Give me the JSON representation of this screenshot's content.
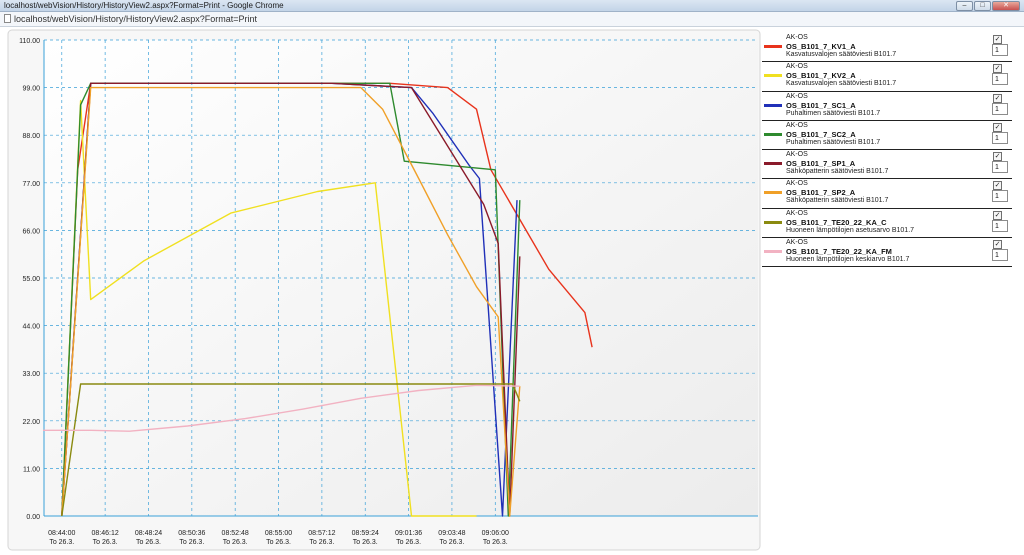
{
  "window": {
    "title": "localhost/webVision/History/HistoryView2.aspx?Format=Print - Google Chrome",
    "url": "localhost/webVision/History/HistoryView2.aspx?Format=Print"
  },
  "chart_data": {
    "type": "line",
    "grid": true,
    "legend_position": "right",
    "ylim": [
      0,
      110
    ],
    "yticks": [
      "0.00",
      "11.00",
      "22.00",
      "33.00",
      "44.00",
      "55.00",
      "66.00",
      "77.00",
      "88.00",
      "99.00",
      "110.00"
    ],
    "xticks": [
      {
        "time": "08:44:00",
        "date": "To 26.3."
      },
      {
        "time": "08:46:12",
        "date": "To 26.3."
      },
      {
        "time": "08:48:24",
        "date": "To 26.3."
      },
      {
        "time": "08:50:36",
        "date": "To 26.3."
      },
      {
        "time": "08:52:48",
        "date": "To 26.3."
      },
      {
        "time": "08:55:00",
        "date": "To 26.3."
      },
      {
        "time": "08:57:12",
        "date": "To 26.3."
      },
      {
        "time": "08:59:24",
        "date": "To 26.3."
      },
      {
        "time": "09:01:36",
        "date": "To 26.3."
      },
      {
        "time": "09:03:48",
        "date": "To 26.3."
      },
      {
        "time": "09:06:00",
        "date": "To 26.3."
      }
    ],
    "series": [
      {
        "group": "AK-OS",
        "name": "OS_B101_7_KV1_A",
        "description": "Kasvatusvalojen säätöviesti B101.7",
        "color": "#e8331c",
        "width": "1",
        "points": [
          [
            1.3,
            0
          ],
          [
            2.4,
            80
          ],
          [
            3.3,
            100
          ],
          [
            24,
            100
          ],
          [
            28,
            99
          ],
          [
            30,
            94
          ],
          [
            31,
            80
          ],
          [
            35,
            57
          ],
          [
            37.5,
            47
          ],
          [
            38,
            39
          ]
        ]
      },
      {
        "group": "AK-OS",
        "name": "OS_B101_7_KV2_A",
        "description": "Kasvatusvalojen säätöviesti B101.7",
        "color": "#f0e020",
        "width": "1",
        "points": [
          [
            1.3,
            0
          ],
          [
            2.6,
            96
          ],
          [
            3.3,
            50
          ],
          [
            7,
            59
          ],
          [
            13,
            70
          ],
          [
            19,
            75
          ],
          [
            23,
            77
          ],
          [
            25.5,
            0
          ],
          [
            30,
            0
          ]
        ]
      },
      {
        "group": "AK-OS",
        "name": "OS_B101_7_SC1_A",
        "description": "Puhaltimen säätöviesti B101.7",
        "color": "#2030b8",
        "width": "1",
        "points": [
          [
            1.3,
            0
          ],
          [
            3.3,
            100
          ],
          [
            20,
            100
          ],
          [
            25.5,
            99
          ],
          [
            27,
            93
          ],
          [
            29.5,
            81
          ],
          [
            30.2,
            78
          ],
          [
            31.8,
            0
          ],
          [
            32.8,
            73
          ]
        ]
      },
      {
        "group": "AK-OS",
        "name": "OS_B101_7_SC2_A",
        "description": "Puhaltimen säätöviesti B101.7",
        "color": "#2e8a2e",
        "width": "1",
        "points": [
          [
            1.3,
            0
          ],
          [
            2.6,
            95
          ],
          [
            3.3,
            100
          ],
          [
            24,
            100
          ],
          [
            25,
            82
          ],
          [
            31.3,
            80
          ],
          [
            32.2,
            0
          ],
          [
            33,
            73
          ]
        ]
      },
      {
        "group": "AK-OS",
        "name": "OS_B101_7_SP1_A",
        "description": "Sähköpatterin säätöviesti B101.7",
        "color": "#8a1a2a",
        "width": "1",
        "points": [
          [
            1.3,
            0
          ],
          [
            3.3,
            100
          ],
          [
            20,
            100
          ],
          [
            25.5,
            99
          ],
          [
            30.5,
            72
          ],
          [
            31.5,
            63
          ],
          [
            32.3,
            0
          ],
          [
            33,
            60
          ]
        ]
      },
      {
        "group": "AK-OS",
        "name": "OS_B101_7_SP2_A",
        "description": "Sähköpatterin säätöviesti B101.7",
        "color": "#f0a028",
        "width": "1",
        "points": [
          [
            1.3,
            0
          ],
          [
            3.3,
            99
          ],
          [
            22,
            99
          ],
          [
            23.5,
            94
          ],
          [
            26,
            78
          ],
          [
            28,
            65
          ],
          [
            30,
            53
          ],
          [
            31.5,
            46
          ],
          [
            32.3,
            0
          ],
          [
            33,
            30
          ]
        ]
      },
      {
        "group": "AK-OS",
        "name": "OS_B101_7_TE20_22_KA_C",
        "description": "Huoneen lämpötilojen asetusarvo B101.7",
        "color": "#8a8a10",
        "width": "1",
        "points": [
          [
            1.3,
            0
          ],
          [
            2.6,
            30.5
          ],
          [
            32.5,
            30.5
          ],
          [
            33,
            26.5
          ]
        ]
      },
      {
        "group": "AK-OS",
        "name": "OS_B101_7_TE20_22_KA_FM",
        "description": "Huoneen lämpötilojen keskiarvo B101.7",
        "color": "#f2b2c2",
        "width": "1",
        "points": [
          [
            0,
            19.8
          ],
          [
            3.3,
            19.8
          ],
          [
            6,
            19.6
          ],
          [
            10,
            20.8
          ],
          [
            14,
            22.5
          ],
          [
            18,
            24.7
          ],
          [
            22,
            27.2
          ],
          [
            26,
            29.0
          ],
          [
            30,
            30.2
          ],
          [
            33,
            30.0
          ]
        ]
      }
    ]
  }
}
